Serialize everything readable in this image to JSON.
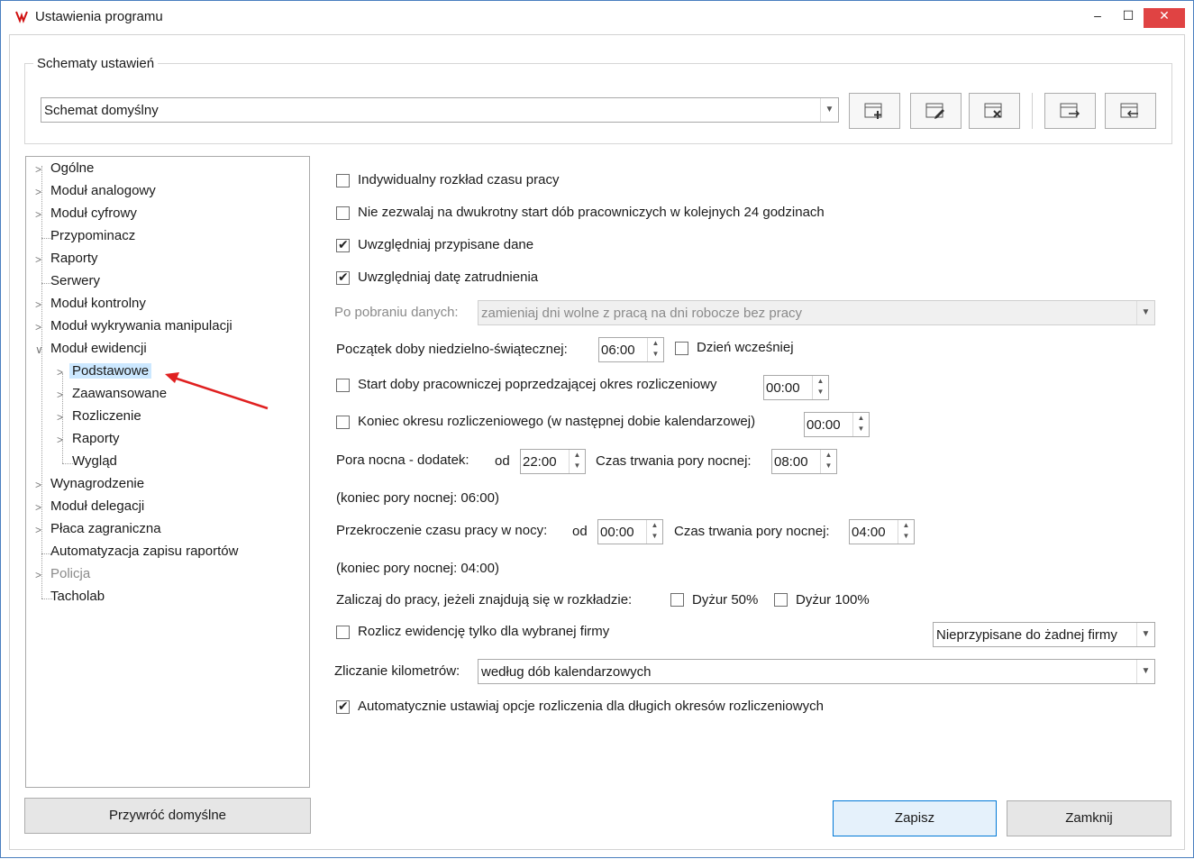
{
  "window": {
    "title": "Ustawienia programu",
    "minimize": "–",
    "maximize": "☐",
    "close": "✕"
  },
  "schemes": {
    "group_label": "Schematy ustawień",
    "selected": "Schemat domyślny"
  },
  "tree": {
    "items": [
      {
        "label": "Ogólne"
      },
      {
        "label": "Moduł analogowy"
      },
      {
        "label": "Moduł cyfrowy"
      },
      {
        "label": "Przypominacz"
      },
      {
        "label": "Raporty"
      },
      {
        "label": "Serwery"
      },
      {
        "label": "Moduł kontrolny"
      },
      {
        "label": "Moduł wykrywania manipulacji"
      },
      {
        "label": "Moduł ewidencji"
      },
      {
        "label": "Podstawowe"
      },
      {
        "label": "Zaawansowane"
      },
      {
        "label": "Rozliczenie"
      },
      {
        "label": "Raporty"
      },
      {
        "label": "Wygląd"
      },
      {
        "label": "Wynagrodzenie"
      },
      {
        "label": "Moduł delegacji"
      },
      {
        "label": "Płaca zagraniczna"
      },
      {
        "label": "Automatyzacja zapisu raportów"
      },
      {
        "label": "Policja"
      },
      {
        "label": "Tacholab"
      }
    ]
  },
  "settings": {
    "individual_schedule": {
      "label": "Indywidualny rozkład czasu pracy",
      "checked": false
    },
    "no_double_start": {
      "label": "Nie zezwalaj na dwukrotny start dób pracowniczych w kolejnych 24 godzinach",
      "checked": false
    },
    "include_assigned": {
      "label": "Uwzględniaj przypisane dane",
      "checked": true
    },
    "include_hire_date": {
      "label": "Uwzględniaj datę zatrudnienia",
      "checked": true
    },
    "after_download": {
      "label": "Po pobraniu danych:",
      "value": "zamieniaj dni wolne z pracą na dni robocze bez pracy"
    },
    "sunday_start": {
      "label": "Początek doby niedzielno-świątecznej:",
      "value": "06:00",
      "earlier_label": "Dzień wcześniej",
      "earlier_checked": false
    },
    "start_before_period": {
      "label": "Start doby pracowniczej poprzedzającej okres rozliczeniowy",
      "value": "00:00",
      "checked": false
    },
    "end_of_period": {
      "label": "Koniec okresu rozliczeniowego (w następnej dobie kalendarzowej)",
      "value": "00:00",
      "checked": false
    },
    "night_bonus": {
      "label": "Pora nocna - dodatek:",
      "from_label": "od",
      "from": "22:00",
      "duration_label": "Czas trwania pory nocnej:",
      "duration": "08:00",
      "end_note": "(koniec pory nocnej:  06:00)"
    },
    "night_overtime": {
      "label": "Przekroczenie czasu pracy w nocy:",
      "from_label": "od",
      "from": "00:00",
      "duration_label": "Czas trwania pory nocnej:",
      "duration": "04:00",
      "end_note": "(koniec pory nocnej:  04:00)"
    },
    "count_duty": {
      "label": "Zaliczaj do pracy, jeżeli znajdują się w rozkładzie:",
      "duty50": "Dyżur 50%",
      "duty100": "Dyżur 100%"
    },
    "selected_company": {
      "label": "Rozlicz ewidencję tylko dla wybranej firmy",
      "value": "Nieprzypisane do żadnej firmy",
      "checked": false
    },
    "km_counting": {
      "label": "Zliczanie kilometrów:",
      "value": "według dób kalendarzowych"
    },
    "auto_long_periods": {
      "label": "Automatycznie ustawiaj opcje rozliczenia dla długich okresów rozliczeniowych",
      "checked": true
    }
  },
  "buttons": {
    "restore": "Przywróć domyślne",
    "save": "Zapisz",
    "close": "Zamknij"
  },
  "colors": {
    "accent": "#0078d7",
    "selection": "#cce8ff",
    "close_red": "#e04343",
    "annotation_arrow": "#e02020"
  }
}
